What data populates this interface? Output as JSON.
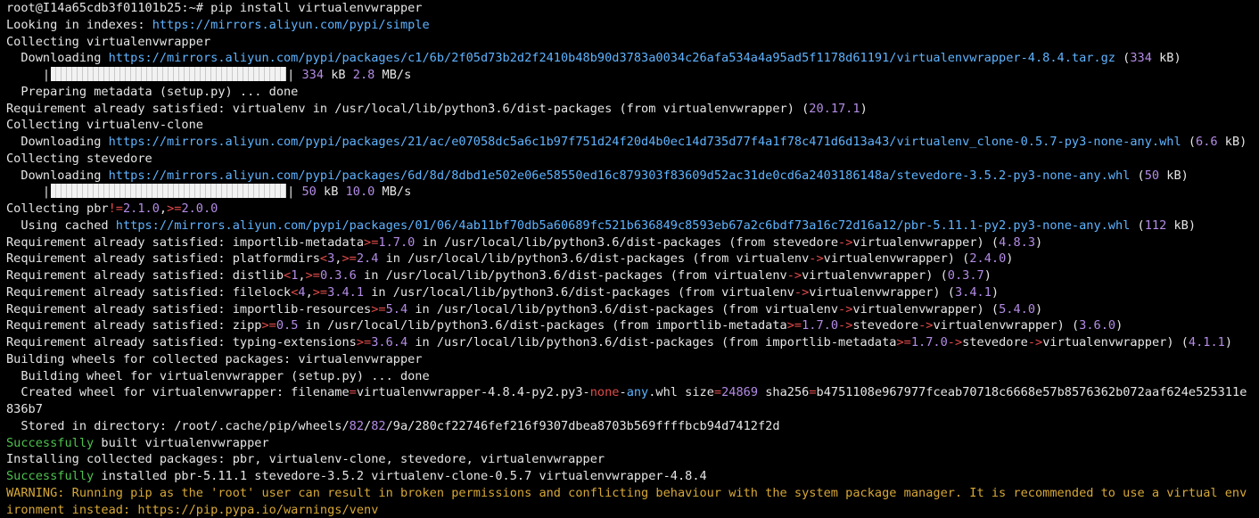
{
  "terminal": {
    "lines": [
      [
        {
          "t": "root@I14a65cdb3f01101b25:~# ",
          "c": "c-prompt"
        },
        {
          "t": "pip install virtualenvwrapper",
          "c": ""
        }
      ],
      [
        {
          "t": "Looking in indexes: ",
          "c": ""
        },
        {
          "t": "https://mirrors.aliyun.com/pypi/simple",
          "c": "c-url"
        }
      ],
      [
        {
          "t": "Collecting virtualenvwrapper",
          "c": ""
        }
      ],
      [
        {
          "t": "  Downloading ",
          "c": ""
        },
        {
          "t": "https://mirrors.aliyun.com/pypi/packages/c1/6b/2f05d73b2d2f2410b48b90d3783a0034c26afa534a4a95ad5f1178d61191/virtualenvwrapper-4.8.4.tar.gz",
          "c": "c-url"
        },
        {
          "t": " (",
          "c": ""
        },
        {
          "t": "334",
          "c": "c-num"
        },
        {
          "t": " kB)",
          "c": ""
        }
      ],
      [
        {
          "t": "     |",
          "c": ""
        },
        {
          "bar": "progress_1"
        },
        {
          "t": "| ",
          "c": ""
        },
        {
          "t": "334",
          "c": "c-num"
        },
        {
          "t": " kB ",
          "c": ""
        },
        {
          "t": "2.8",
          "c": "c-num"
        },
        {
          "t": " MB/s",
          "c": ""
        }
      ],
      [
        {
          "t": "  Preparing metadata (setup.py) ... done",
          "c": ""
        }
      ],
      [
        {
          "t": "Requirement already satisfied: virtualenv in /usr/local/lib/python3.6/dist-packages (from virtualenvwrapper) (",
          "c": ""
        },
        {
          "t": "20.17.1",
          "c": "c-num"
        },
        {
          "t": ")",
          "c": ""
        }
      ],
      [
        {
          "t": "Collecting virtualenv-clone",
          "c": ""
        }
      ],
      [
        {
          "t": "  Downloading ",
          "c": ""
        },
        {
          "t": "https://mirrors.aliyun.com/pypi/packages/21/ac/e07058dc5a6c1b97f751d24f20d4b0ec14d735d77f4a1f78c471d6d13a43/virtualenv_clone-0.5.7-py3-none-any.whl",
          "c": "c-url"
        },
        {
          "t": " (",
          "c": ""
        },
        {
          "t": "6.6",
          "c": "c-num"
        },
        {
          "t": " kB)",
          "c": ""
        }
      ],
      [
        {
          "t": "Collecting stevedore",
          "c": ""
        }
      ],
      [
        {
          "t": "  Downloading ",
          "c": ""
        },
        {
          "t": "https://mirrors.aliyun.com/pypi/packages/6d/8d/8dbd1e502e06e58550ed16c879303f83609d52ac31de0cd6a2403186148a/stevedore-3.5.2-py3-none-any.whl",
          "c": "c-url"
        },
        {
          "t": " (",
          "c": ""
        },
        {
          "t": "50",
          "c": "c-num"
        },
        {
          "t": " kB)",
          "c": ""
        }
      ],
      [
        {
          "t": "     |",
          "c": ""
        },
        {
          "bar": "progress_2"
        },
        {
          "t": "| ",
          "c": ""
        },
        {
          "t": "50",
          "c": "c-num"
        },
        {
          "t": " kB ",
          "c": ""
        },
        {
          "t": "10.0",
          "c": "c-num"
        },
        {
          "t": " MB/s",
          "c": ""
        }
      ],
      [
        {
          "t": "Collecting pbr",
          "c": ""
        },
        {
          "t": "!=",
          "c": "c-op"
        },
        {
          "t": "2.1.0",
          "c": "c-num"
        },
        {
          "t": ",",
          "c": ""
        },
        {
          "t": ">=",
          "c": "c-op"
        },
        {
          "t": "2.0.0",
          "c": "c-num"
        }
      ],
      [
        {
          "t": "  Using cached ",
          "c": ""
        },
        {
          "t": "https://mirrors.aliyun.com/pypi/packages/01/06/4ab11bf70db5a60689fc521b636849c8593eb67a2c6bdf73a16c72d16a12/pbr-5.11.1-py2.py3-none-any.whl",
          "c": "c-url"
        },
        {
          "t": " (",
          "c": ""
        },
        {
          "t": "112",
          "c": "c-num"
        },
        {
          "t": " kB)",
          "c": ""
        }
      ],
      [
        {
          "t": "Requirement already satisfied: importlib-metadata",
          "c": ""
        },
        {
          "t": ">=",
          "c": "c-op"
        },
        {
          "t": "1.7.0",
          "c": "c-num"
        },
        {
          "t": " in /usr/local/lib/python3.6/dist-packages (from stevedore",
          "c": ""
        },
        {
          "t": "->",
          "c": "c-op"
        },
        {
          "t": "virtualenvwrapper) (",
          "c": ""
        },
        {
          "t": "4.8.3",
          "c": "c-num"
        },
        {
          "t": ")",
          "c": ""
        }
      ],
      [
        {
          "t": "Requirement already satisfied: platformdirs",
          "c": ""
        },
        {
          "t": "<",
          "c": "c-op"
        },
        {
          "t": "3",
          "c": "c-num"
        },
        {
          "t": ",",
          "c": ""
        },
        {
          "t": ">=",
          "c": "c-op"
        },
        {
          "t": "2.4",
          "c": "c-num"
        },
        {
          "t": " in /usr/local/lib/python3.6/dist-packages (from virtualenv",
          "c": ""
        },
        {
          "t": "->",
          "c": "c-op"
        },
        {
          "t": "virtualenvwrapper) (",
          "c": ""
        },
        {
          "t": "2.4.0",
          "c": "c-num"
        },
        {
          "t": ")",
          "c": ""
        }
      ],
      [
        {
          "t": "Requirement already satisfied: distlib",
          "c": ""
        },
        {
          "t": "<",
          "c": "c-op"
        },
        {
          "t": "1",
          "c": "c-num"
        },
        {
          "t": ",",
          "c": ""
        },
        {
          "t": ">=",
          "c": "c-op"
        },
        {
          "t": "0.3.6",
          "c": "c-num"
        },
        {
          "t": " in /usr/local/lib/python3.6/dist-packages (from virtualenv",
          "c": ""
        },
        {
          "t": "->",
          "c": "c-op"
        },
        {
          "t": "virtualenvwrapper) (",
          "c": ""
        },
        {
          "t": "0.3.7",
          "c": "c-num"
        },
        {
          "t": ")",
          "c": ""
        }
      ],
      [
        {
          "t": "Requirement already satisfied: filelock",
          "c": ""
        },
        {
          "t": "<",
          "c": "c-op"
        },
        {
          "t": "4",
          "c": "c-num"
        },
        {
          "t": ",",
          "c": ""
        },
        {
          "t": ">=",
          "c": "c-op"
        },
        {
          "t": "3.4.1",
          "c": "c-num"
        },
        {
          "t": " in /usr/local/lib/python3.6/dist-packages (from virtualenv",
          "c": ""
        },
        {
          "t": "->",
          "c": "c-op"
        },
        {
          "t": "virtualenvwrapper) (",
          "c": ""
        },
        {
          "t": "3.4.1",
          "c": "c-num"
        },
        {
          "t": ")",
          "c": ""
        }
      ],
      [
        {
          "t": "Requirement already satisfied: importlib-resources",
          "c": ""
        },
        {
          "t": ">=",
          "c": "c-op"
        },
        {
          "t": "5.4",
          "c": "c-num"
        },
        {
          "t": " in /usr/local/lib/python3.6/dist-packages (from virtualenv",
          "c": ""
        },
        {
          "t": "->",
          "c": "c-op"
        },
        {
          "t": "virtualenvwrapper) (",
          "c": ""
        },
        {
          "t": "5.4.0",
          "c": "c-num"
        },
        {
          "t": ")",
          "c": ""
        }
      ],
      [
        {
          "t": "Requirement already satisfied: zipp",
          "c": ""
        },
        {
          "t": ">=",
          "c": "c-op"
        },
        {
          "t": "0.5",
          "c": "c-num"
        },
        {
          "t": " in /usr/local/lib/python3.6/dist-packages (from importlib-metadata",
          "c": ""
        },
        {
          "t": ">=",
          "c": "c-op"
        },
        {
          "t": "1.7.0",
          "c": "c-num"
        },
        {
          "t": "->",
          "c": "c-op"
        },
        {
          "t": "stevedore",
          "c": ""
        },
        {
          "t": "->",
          "c": "c-op"
        },
        {
          "t": "virtualenvwrapper) (",
          "c": ""
        },
        {
          "t": "3.6.0",
          "c": "c-num"
        },
        {
          "t": ")",
          "c": ""
        }
      ],
      [
        {
          "t": "Requirement already satisfied: typing-extensions",
          "c": ""
        },
        {
          "t": ">=",
          "c": "c-op"
        },
        {
          "t": "3.6.4",
          "c": "c-num"
        },
        {
          "t": " in /usr/local/lib/python3.6/dist-packages (from importlib-metadata",
          "c": ""
        },
        {
          "t": ">=",
          "c": "c-op"
        },
        {
          "t": "1.7.0",
          "c": "c-num"
        },
        {
          "t": "->",
          "c": "c-op"
        },
        {
          "t": "stevedore",
          "c": ""
        },
        {
          "t": "->",
          "c": "c-op"
        },
        {
          "t": "virtualenvwrapper) (",
          "c": ""
        },
        {
          "t": "4.1.1",
          "c": "c-num"
        },
        {
          "t": ")",
          "c": ""
        }
      ],
      [
        {
          "t": "Building wheels for collected packages: virtualenvwrapper",
          "c": ""
        }
      ],
      [
        {
          "t": "  Building wheel for virtualenvwrapper (setup.py) ... done",
          "c": ""
        }
      ],
      [
        {
          "t": "  Created wheel for virtualenvwrapper: filename",
          "c": ""
        },
        {
          "t": "=",
          "c": "c-op"
        },
        {
          "t": "virtualenvwrapper-4.8.4-py2.py3-",
          "c": ""
        },
        {
          "t": "none",
          "c": "c-op"
        },
        {
          "t": "-",
          "c": ""
        },
        {
          "t": "any",
          "c": "c-url"
        },
        {
          "t": ".whl size",
          "c": ""
        },
        {
          "t": "=",
          "c": "c-op"
        },
        {
          "t": "24869",
          "c": "c-num"
        },
        {
          "t": " sha256",
          "c": ""
        },
        {
          "t": "=",
          "c": "c-op"
        },
        {
          "t": "b4751108e967977fceab70718c6668e57b8576362b072aaf624e525311e",
          "c": ""
        }
      ],
      [
        {
          "t": "836b7",
          "c": ""
        }
      ],
      [
        {
          "t": "  Stored in directory: /root/.cache/pip/wheels/",
          "c": ""
        },
        {
          "t": "82",
          "c": "c-num"
        },
        {
          "t": "/",
          "c": ""
        },
        {
          "t": "82",
          "c": "c-num"
        },
        {
          "t": "/9a/280cf22746fef216f9307dbea8703b569ffffbcb94d7412f2d",
          "c": ""
        }
      ],
      [
        {
          "t": "Successfully",
          "c": "c-green"
        },
        {
          "t": " built virtualenvwrapper",
          "c": ""
        }
      ],
      [
        {
          "t": "Installing collected packages: pbr, virtualenv-clone, stevedore, virtualenvwrapper",
          "c": ""
        }
      ],
      [
        {
          "t": "Successfully",
          "c": "c-green"
        },
        {
          "t": " installed pbr-5.11.1 stevedore-3.5.2 virtualenv-clone-0.5.7 virtualenvwrapper-4.8.4",
          "c": ""
        }
      ],
      [
        {
          "t": "WARNING: Running pip as the 'root' user can result in broken permissions and conflicting behaviour with the system package manager. It is recommended to use a virtual env",
          "c": "c-warn"
        }
      ],
      [
        {
          "t": "ironment instead: https://pip.pypa.io/warnings/venv",
          "c": "c-warn"
        }
      ]
    ]
  },
  "progress": {
    "progress_1": 1.0,
    "progress_2": 1.0
  },
  "colors": {
    "background": "#000000",
    "text": "#e6e6e6",
    "url": "#5fb3ff",
    "number": "#b48ce6",
    "operator": "#e04b4b",
    "success": "#4ec24e",
    "warning": "#d8a837"
  }
}
